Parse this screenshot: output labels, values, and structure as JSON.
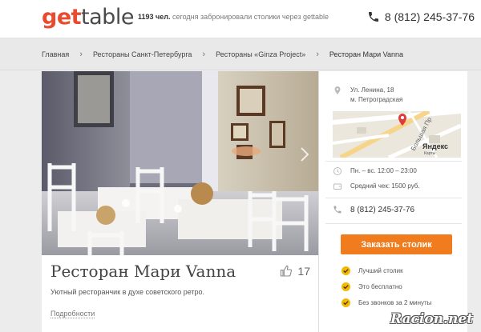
{
  "header": {
    "logo_part1": "get",
    "logo_part2": "table",
    "tagline_count": "1193 чел.",
    "tagline_text": "сегодня забронировали столики через gettable",
    "phone": "8 (812) 245-37-76"
  },
  "breadcrumbs": [
    "Главная",
    "Рестораны Санкт-Петербурга",
    "Рестораны «Ginza Project»",
    "Ресторан Мари Vanna"
  ],
  "restaurant": {
    "name": "Ресторан Мари Vanna",
    "likes": "17",
    "description": "Уютный ресторанчик в духе советского ретро.",
    "details_link": "Подробности"
  },
  "sidebar": {
    "address_line1": "Ул. Ленина, 18",
    "address_line2": "м. Петроградская",
    "map_street": "Большая Пр",
    "map_brand": "Яндекс",
    "map_brand2": "Карты",
    "hours": "Пн. – вс. 12:00 – 23:00",
    "avg_check": "Средний чек: 1500 руб.",
    "phone": "8 (812) 245-37-76",
    "book_button": "Заказать столик",
    "benefits": [
      "Лучший столик",
      "Это бесплатно",
      "Без звонков за 2 минуты"
    ]
  },
  "watermark": "Racion.net",
  "icons": [
    "phone-icon",
    "chevron-right-icon",
    "like-icon",
    "map-pin-icon",
    "clock-icon",
    "wallet-icon",
    "check-icon"
  ],
  "colors": {
    "accent": "#e84b2f",
    "button": "#f07c1e",
    "check": "#f5b800"
  }
}
